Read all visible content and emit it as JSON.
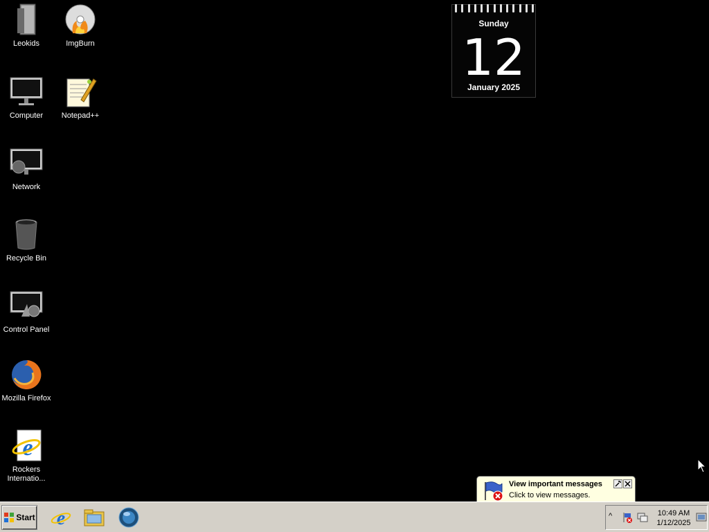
{
  "desktop": {
    "icons": [
      {
        "label": "Leokids",
        "icon": "folder-icon"
      },
      {
        "label": "ImgBurn",
        "icon": "disc-burn-icon"
      },
      {
        "label": "Computer",
        "icon": "computer-icon"
      },
      {
        "label": "Notepad++",
        "icon": "notepad-icon"
      },
      {
        "label": "Network",
        "icon": "network-icon"
      },
      {
        "label": "Recycle Bin",
        "icon": "recycle-bin-icon"
      },
      {
        "label": "Control Panel",
        "icon": "control-panel-icon"
      },
      {
        "label": "Mozilla Firefox",
        "icon": "firefox-icon"
      },
      {
        "label": "Rockers Internatio...",
        "icon": "internet-explorer-shortcut-icon"
      }
    ]
  },
  "calendar": {
    "day_name": "Sunday",
    "day_number": "12",
    "month_year": "January 2025"
  },
  "balloon": {
    "title": "View important messages",
    "message": "Click to view messages.",
    "icon": "action-center-flag-icon"
  },
  "taskbar": {
    "start_label": "Start",
    "quick_launch": [
      "internet-explorer-icon",
      "windows-explorer-icon",
      "media-player-icon"
    ],
    "tray": {
      "chevron": "^",
      "time": "10:49 AM",
      "date": "1/12/2025"
    }
  }
}
